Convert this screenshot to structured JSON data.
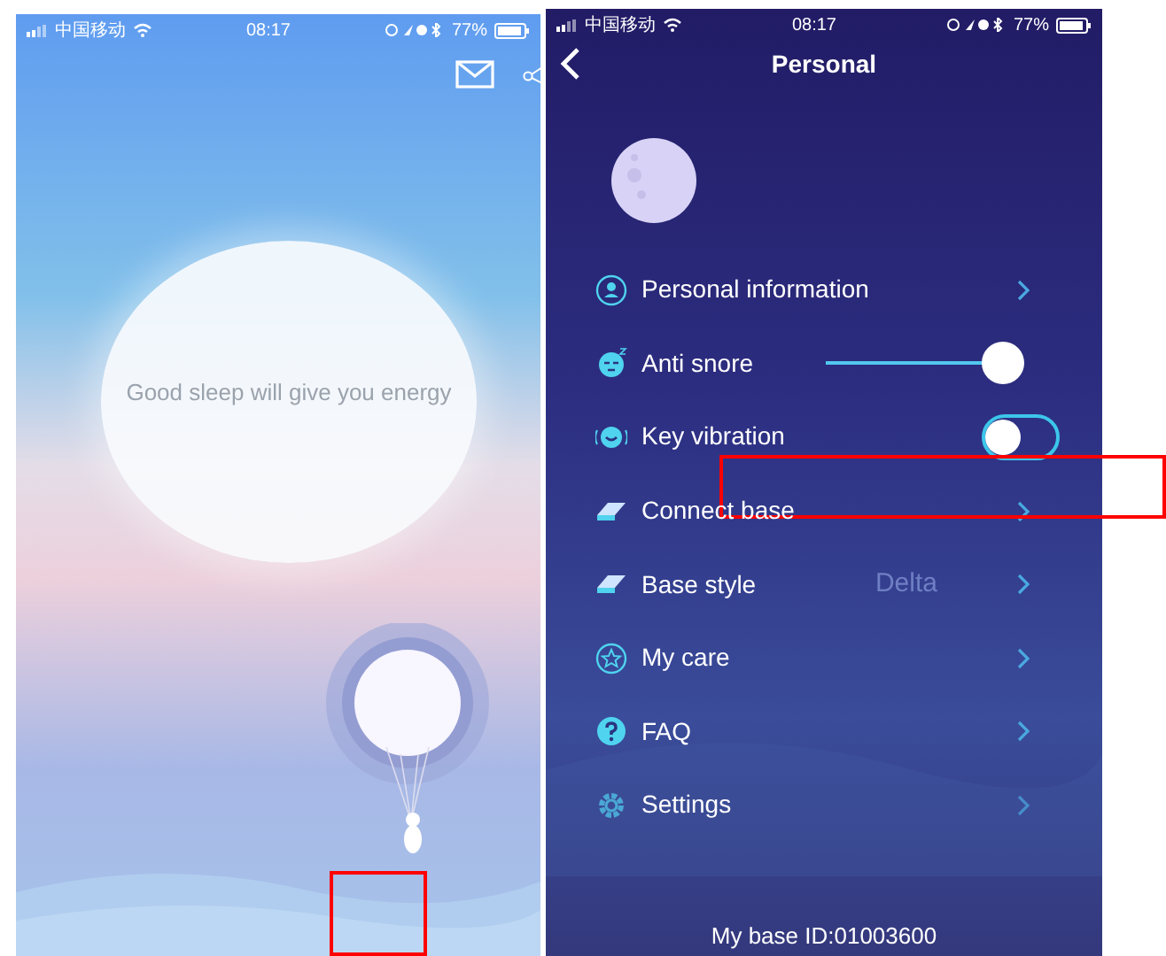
{
  "home_screen": {
    "status_bar": {
      "carrier": "中国移动",
      "time": "08:17",
      "battery": "77%"
    },
    "tagline": "Good sleep will give you energy"
  },
  "personal_screen": {
    "status_bar": {
      "carrier": "中国移动",
      "time": "08:17",
      "battery": "77%"
    },
    "title": "Personal",
    "menu": [
      {
        "kind": "link",
        "label": "Personal information"
      },
      {
        "kind": "slider",
        "label": "Anti snore",
        "level": 1
      },
      {
        "kind": "toggle",
        "label": "Key vibration",
        "on": false
      },
      {
        "kind": "link",
        "label": "Connect base"
      },
      {
        "kind": "link",
        "label": "Base style",
        "value": "Delta"
      },
      {
        "kind": "link",
        "label": "My care"
      },
      {
        "kind": "link",
        "label": "FAQ"
      },
      {
        "kind": "link",
        "label": "Settings"
      }
    ],
    "footer": "My base ID:01003600"
  }
}
